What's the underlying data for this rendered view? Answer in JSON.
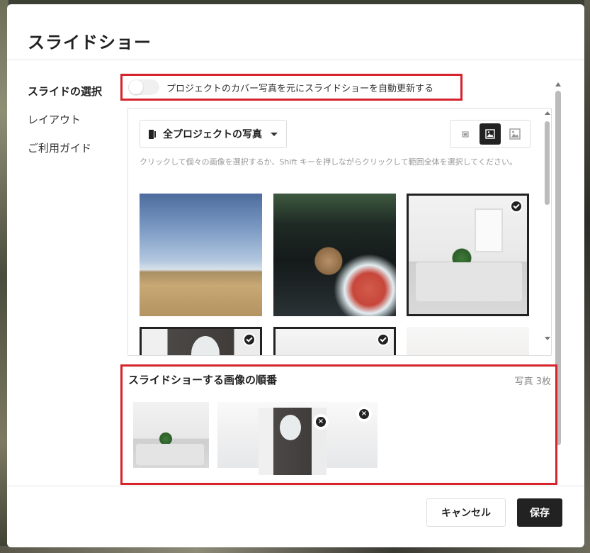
{
  "modal": {
    "title": "スライドショー"
  },
  "sidebar": {
    "items": [
      {
        "label": "スライドの選択",
        "active": true
      },
      {
        "label": "レイアウト",
        "active": false
      },
      {
        "label": "ご利用ガイド",
        "active": false
      }
    ]
  },
  "toggle": {
    "label": "プロジェクトのカバー写真を元にスライドショーを自動更新する",
    "on": false
  },
  "photos": {
    "filter_label": "全プロジェクトの写真",
    "hint": "クリックして個々の画像を選択するか、Shift キーを押しながらクリックして範囲全体を選択してください。",
    "size_options": [
      "small-image-icon",
      "medium-image-icon",
      "large-image-icon"
    ],
    "active_size": "medium-image-icon",
    "items": [
      {
        "icon": "sky-desert-photo",
        "selected": false
      },
      {
        "icon": "coconut-drink-photo",
        "selected": false
      },
      {
        "icon": "bedroom-photo",
        "selected": true
      },
      {
        "icon": "bathroom-photo",
        "selected": true
      },
      {
        "icon": "kitchen-photo",
        "selected": true
      },
      {
        "icon": "hallway-photo",
        "selected": false
      }
    ]
  },
  "order": {
    "title": "スライドショーする画像の順番",
    "count": "写真 3枚"
  },
  "footer": {
    "cancel_label": "キャンセル",
    "save_label": "保存"
  },
  "colors": {
    "highlight": "#d6232c",
    "primary": "#222222"
  }
}
